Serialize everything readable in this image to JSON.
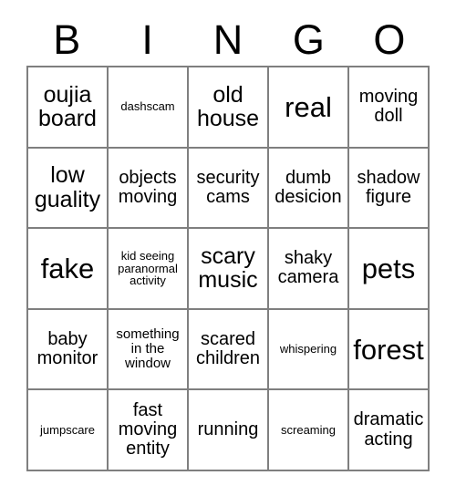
{
  "card": {
    "header": {
      "letters": [
        "B",
        "I",
        "N",
        "G",
        "O"
      ]
    },
    "rows": [
      [
        {
          "text": "oujia board",
          "size": "lg"
        },
        {
          "text": "dashscam",
          "size": "xs"
        },
        {
          "text": "old house",
          "size": "lg"
        },
        {
          "text": "real",
          "size": "xl"
        },
        {
          "text": "moving doll",
          "size": "md"
        }
      ],
      [
        {
          "text": "low guality",
          "size": "lg"
        },
        {
          "text": "objects moving",
          "size": "md"
        },
        {
          "text": "security cams",
          "size": "md"
        },
        {
          "text": "dumb desicion",
          "size": "md"
        },
        {
          "text": "shadow figure",
          "size": "md"
        }
      ],
      [
        {
          "text": "fake",
          "size": "xl"
        },
        {
          "text": "kid seeing paranormal activity",
          "size": "xs"
        },
        {
          "text": "scary music",
          "size": "lg"
        },
        {
          "text": "shaky camera",
          "size": "md"
        },
        {
          "text": "pets",
          "size": "xl"
        }
      ],
      [
        {
          "text": "baby monitor",
          "size": "md"
        },
        {
          "text": "something in the window",
          "size": "sm"
        },
        {
          "text": "scared children",
          "size": "md"
        },
        {
          "text": "whispering",
          "size": "xs"
        },
        {
          "text": "forest",
          "size": "xl"
        }
      ],
      [
        {
          "text": "jumpscare",
          "size": "xs"
        },
        {
          "text": "fast moving entity",
          "size": "md"
        },
        {
          "text": "running",
          "size": "md"
        },
        {
          "text": "screaming",
          "size": "xs"
        },
        {
          "text": "dramatic acting",
          "size": "md"
        }
      ]
    ]
  },
  "colors": {
    "background": "#ffffff",
    "border": "#7f7f7f",
    "text": "#000000"
  }
}
